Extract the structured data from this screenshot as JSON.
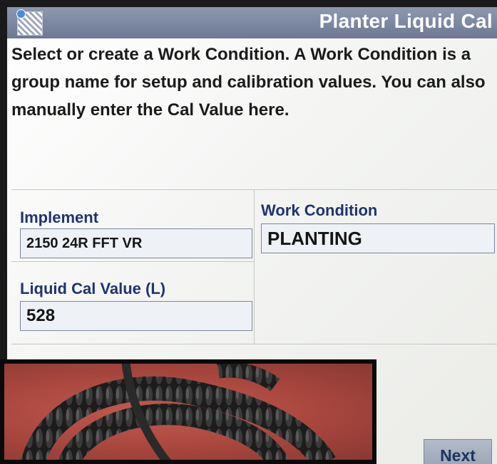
{
  "title": "Planter Liquid Cal",
  "instructions": "Select or create a Work Condition. A Work Condition is a group name for setup and calibration values. You can also manually enter the Cal Value here.",
  "fields": {
    "implement": {
      "label": "Implement",
      "value": "2150 24R FFT VR"
    },
    "work_condition": {
      "label": "Work Condition",
      "value": "PLANTING"
    },
    "liquid_cal": {
      "label": "Liquid Cal Value (L)",
      "value": "528"
    }
  },
  "next_label": "Next",
  "colors": {
    "titlebar": "#7a85a0",
    "label_text": "#1f3470",
    "field_background": "#eef1f5",
    "photo_surface": "#a8463e",
    "cable": "#2a2a2a"
  },
  "photo_icon": "coiled-cable-photo"
}
